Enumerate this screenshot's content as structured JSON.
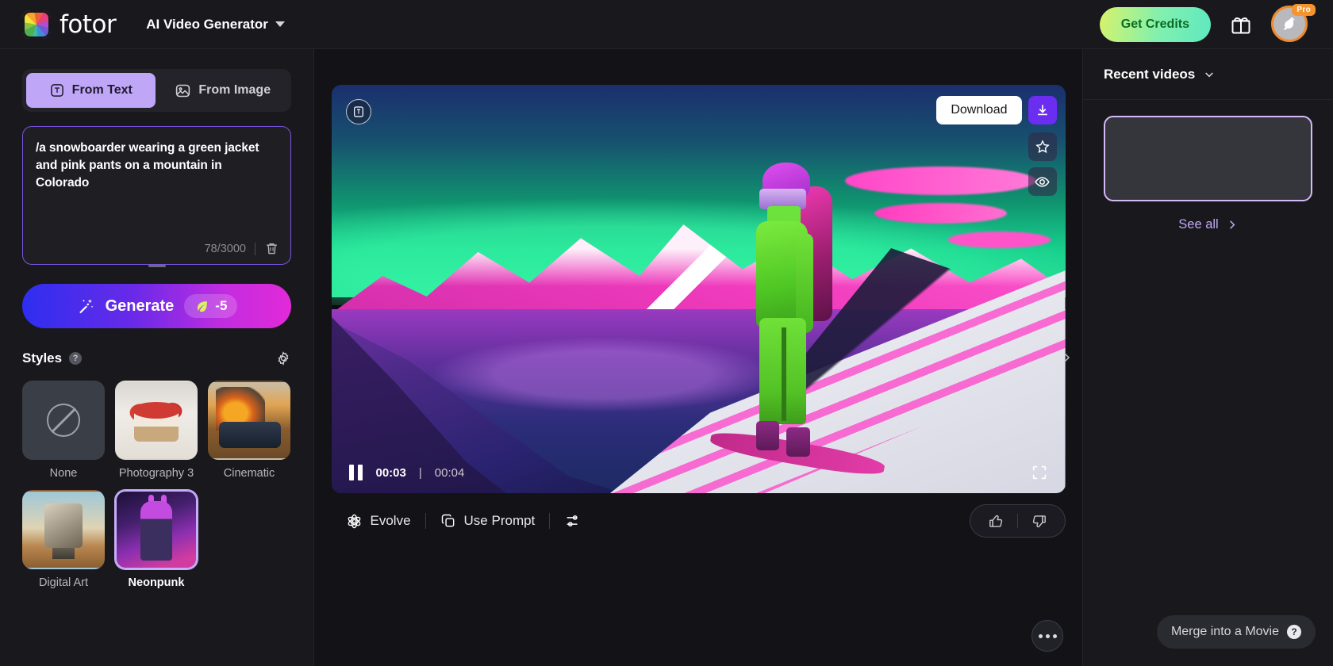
{
  "header": {
    "brand": "fotor",
    "app_title": "AI Video Generator",
    "get_credits_label": "Get Credits",
    "gift_icon": "gift-icon",
    "avatar_badge": "Pro",
    "chevron_icon": "chevron-down-icon"
  },
  "left_panel": {
    "tabs": [
      {
        "label": "From Text",
        "icon": "text-box-icon",
        "active": true
      },
      {
        "label": "From Image",
        "icon": "image-icon",
        "active": false
      }
    ],
    "prompt": {
      "value": "/a snowboarder wearing a green jacket and pink pants on a mountain in Colorado",
      "char_count": "78/3000",
      "delete_icon": "trash-icon"
    },
    "generate": {
      "label": "Generate",
      "credit_cost": "-5",
      "credit_icon": "leaf-icon",
      "wand_icon": "magic-wand-icon"
    },
    "styles": {
      "title": "Styles",
      "help_icon": "question-mark-icon",
      "settings_icon": "gear-icon",
      "items": [
        {
          "label": "None",
          "selected": false
        },
        {
          "label": "Photography 3",
          "selected": false
        },
        {
          "label": "Cinematic",
          "selected": false
        },
        {
          "label": "Digital Art",
          "selected": false
        },
        {
          "label": "Neonpunk",
          "selected": true
        }
      ]
    }
  },
  "player": {
    "text_badge_icon": "text-overlay-icon",
    "download_label": "Download",
    "download_icon": "download-icon",
    "favorite_icon": "star-icon",
    "preview_icon": "eye-icon",
    "pause_icon": "pause-icon",
    "current_time": "00:03",
    "time_separator": "|",
    "total_time": "00:04",
    "fullscreen_icon": "fullscreen-icon"
  },
  "toolbar": {
    "evolve_label": "Evolve",
    "evolve_icon": "atom-icon",
    "use_prompt_label": "Use Prompt",
    "use_prompt_icon": "copy-icon",
    "settings_icon": "sliders-icon",
    "like_icon": "thumbs-up-icon",
    "dislike_icon": "thumbs-down-icon",
    "more_icon": "ellipsis-icon",
    "collapse_icon": "chevron-right-icon"
  },
  "right_panel": {
    "title": "Recent videos",
    "collapse_icon": "chevron-down-icon",
    "see_all_label": "See all",
    "see_all_icon": "chevron-right-icon",
    "merge_label": "Merge into a Movie",
    "merge_help_icon": "question-mark-icon"
  },
  "colors": {
    "accent_purple": "#7b54e0",
    "accent_lilac": "#c0a6f7",
    "credits_green": "#7ff0b0",
    "pro_orange": "#f5932f",
    "generate_gradient_from": "#2e2ef0",
    "generate_gradient_to": "#e22ad8"
  }
}
